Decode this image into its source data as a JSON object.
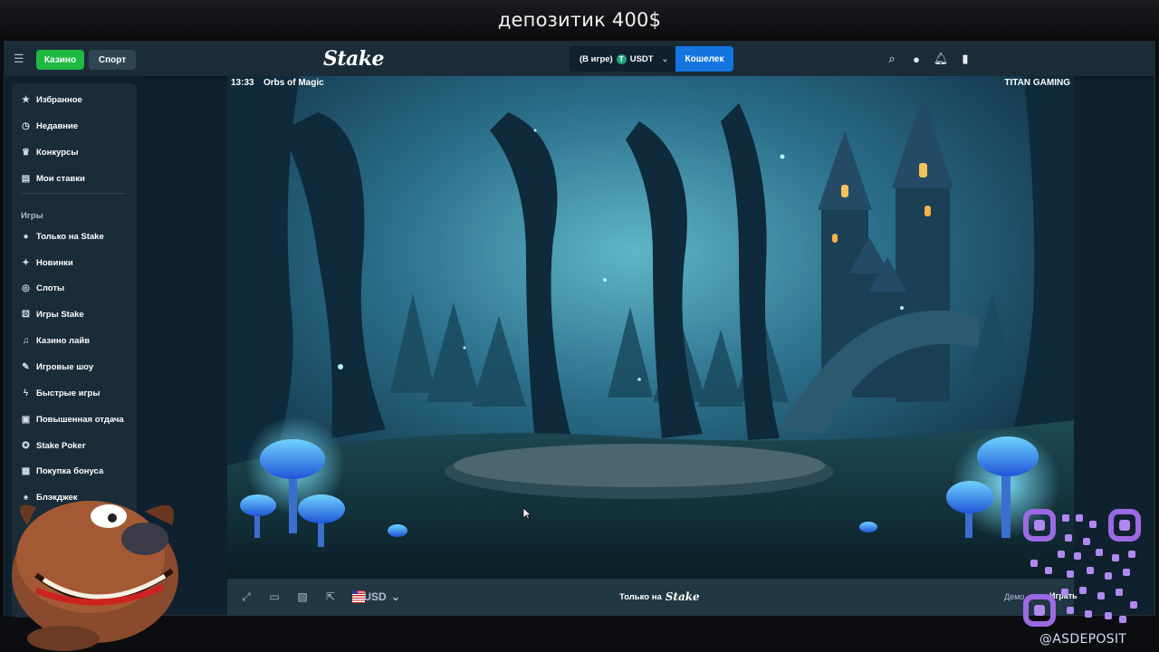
{
  "stream": {
    "title": "депозитик 400$"
  },
  "topbar": {
    "casino_tab": "Казино",
    "sport_tab": "Спорт",
    "logo": "Stake",
    "balance_label": "(В игре)",
    "currency": "USDT",
    "wallet_button": "Кошелек",
    "icons": [
      "search-icon",
      "user-icon",
      "bell-icon",
      "sidebar-toggle-icon"
    ]
  },
  "sidebar": {
    "top_items": [
      {
        "label": "Избранное",
        "icon": "star-icon"
      },
      {
        "label": "Недавние",
        "icon": "clock-icon"
      },
      {
        "label": "Конкурсы",
        "icon": "trophy-icon"
      },
      {
        "label": "Мои ставки",
        "icon": "receipt-icon"
      }
    ],
    "games_heading": "Игры",
    "games_items": [
      {
        "label": "Только на Stake",
        "icon": "stake-icon"
      },
      {
        "label": "Новинки",
        "icon": "sparkle-icon"
      },
      {
        "label": "Слоты",
        "icon": "slots-icon"
      },
      {
        "label": "Игры Stake",
        "icon": "dice-icon"
      },
      {
        "label": "Казино лайв",
        "icon": "live-icon"
      },
      {
        "label": "Игровые шоу",
        "icon": "mic-icon"
      },
      {
        "label": "Быстрые игры",
        "icon": "bolt-icon"
      },
      {
        "label": "Повышенная отдача",
        "icon": "chart-icon"
      },
      {
        "label": "Stake Poker",
        "icon": "poker-chip-icon"
      },
      {
        "label": "Покупка бонуса",
        "icon": "gift-icon"
      },
      {
        "label": "Блэкджек",
        "icon": "cards-icon"
      }
    ]
  },
  "game": {
    "time": "13:33",
    "name": "Orbs of Magic",
    "provider": "TITAN GAMING"
  },
  "game_bar": {
    "currency": "USD",
    "only_on": "Только на",
    "only_on_logo": "Stake",
    "demo_label": "Демо",
    "real_label": "Играть"
  },
  "overlay": {
    "watermark": "@ASDEPOSIT"
  }
}
